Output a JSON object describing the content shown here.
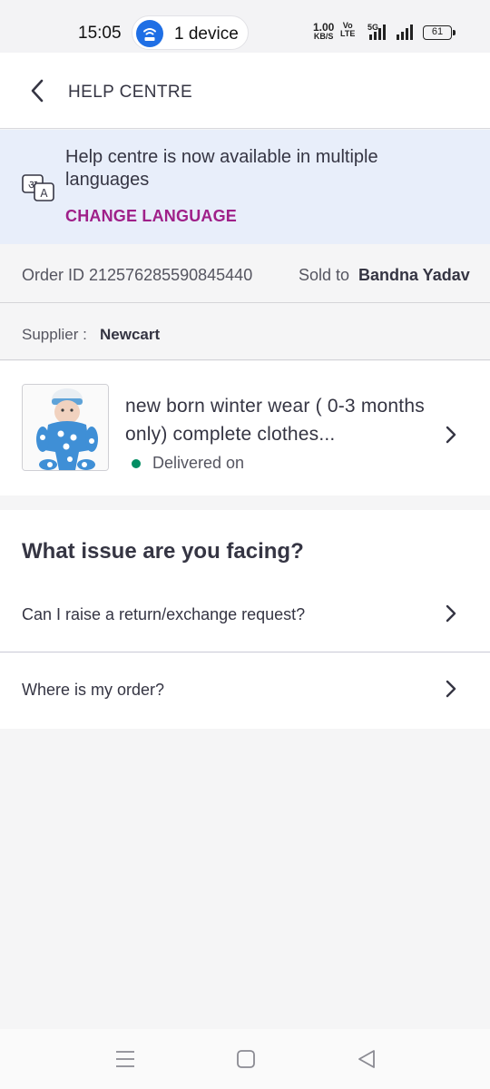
{
  "status_bar": {
    "time": "15:05",
    "hotspot_label": "1 device",
    "net_speed_value": "1.00",
    "net_speed_unit": "KB/S",
    "volte_top": "Vo",
    "volte_bottom": "LTE",
    "network_type": "5G",
    "battery": "61"
  },
  "header": {
    "title": "HELP CENTRE",
    "back_icon": "chevron-left-icon"
  },
  "banner": {
    "message": "Help centre is now available in multiple languages",
    "action_label": "CHANGE LANGUAGE",
    "icon": "language-icon",
    "action_color": "#9f2089",
    "background": "#e8eefa"
  },
  "order": {
    "id_text": "Order ID 212576285590845440",
    "sold_to_label": "Sold to",
    "sold_to_name": "Bandna Yadav",
    "supplier_label": "Supplier :",
    "supplier_name": "Newcart"
  },
  "product": {
    "title": " new born winter wear ( 0-3 months only) complete clothes...",
    "status": "Delivered on",
    "status_color": "#038d63",
    "image_icon": "baby-product-image"
  },
  "issues": {
    "heading": "What issue are you facing?",
    "items": [
      {
        "label": "Can I raise a return/exchange request?"
      },
      {
        "label": "Where is my order?"
      }
    ]
  },
  "nav": {
    "menu_icon": "menu-icon",
    "home_icon": "home-square-icon",
    "back_icon": "back-triangle-icon"
  }
}
